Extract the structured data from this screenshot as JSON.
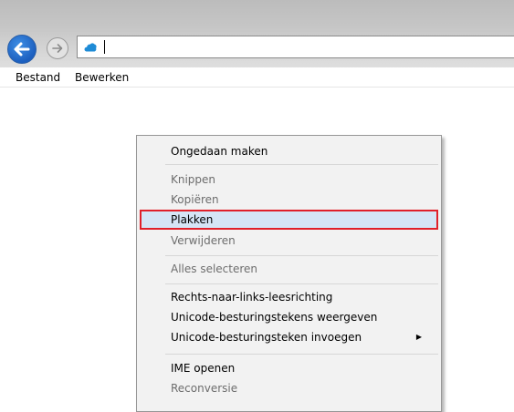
{
  "menubar": {
    "items": [
      "Bestand",
      "Bewerken"
    ]
  },
  "context_menu": {
    "items": [
      {
        "label": "Ongedaan maken",
        "enabled": true
      },
      {
        "label": "Knippen",
        "enabled": false
      },
      {
        "label": "Kopiëren",
        "enabled": false
      },
      {
        "label": "Plakken",
        "enabled": true,
        "highlighted": true
      },
      {
        "label": "Verwijderen",
        "enabled": false
      },
      {
        "label": "Alles selecteren",
        "enabled": false
      },
      {
        "label": "Rechts-naar-links-leesrichting",
        "enabled": true
      },
      {
        "label": "Unicode-besturingstekens weergeven",
        "enabled": true
      },
      {
        "label": "Unicode-besturingsteken invoegen",
        "enabled": true,
        "submenu": true
      },
      {
        "label": "IME openen",
        "enabled": true
      },
      {
        "label": "Reconversie",
        "enabled": false
      }
    ]
  },
  "icons": {
    "back": "arrow-left-icon",
    "forward": "arrow-right-icon",
    "favicon": "cloud-icon",
    "submenu": "triangle-right-icon"
  },
  "colors": {
    "highlight_border": "#e0202a",
    "highlight_fill": "#d5e5f6",
    "back_button": "#1c5fbf"
  }
}
